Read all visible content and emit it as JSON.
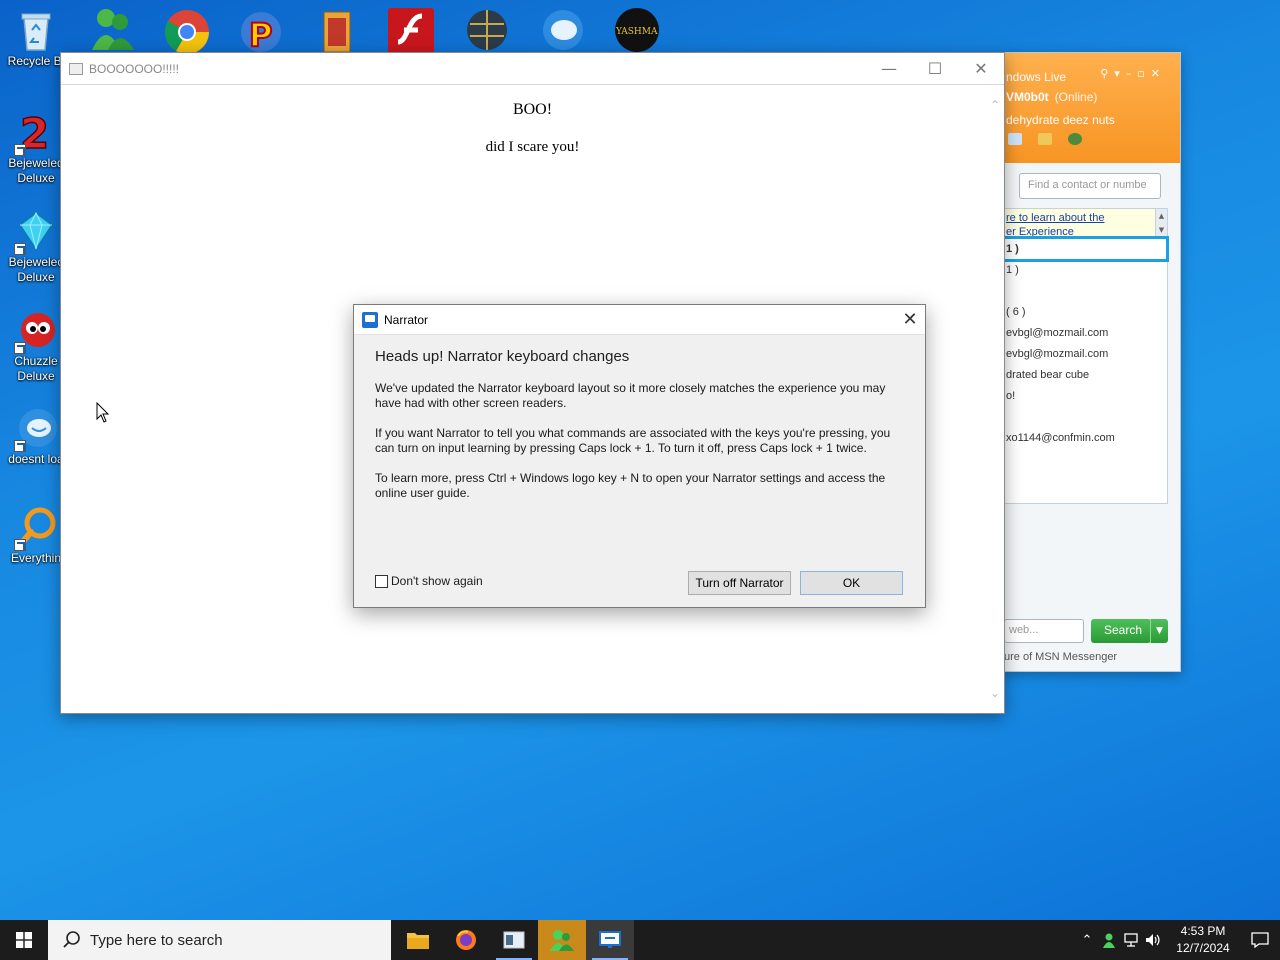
{
  "desktop": {
    "icons": [
      {
        "label": "Recycle Bi",
        "icon": "recycle-bin-icon"
      },
      {
        "label": "Bejeweled",
        "label2": "Deluxe",
        "icon": "bejeweled2-icon"
      },
      {
        "label": "Bejewelec",
        "label2": "Deluxe",
        "icon": "bejeweled-icon"
      },
      {
        "label": "Chuzzle",
        "label2": "Deluxe",
        "icon": "chuzzle-icon"
      },
      {
        "label": "doesnt loa",
        "icon": "messenger-bird-icon"
      },
      {
        "label": "Everythin",
        "icon": "everything-search-icon"
      }
    ],
    "top_row_icons": [
      "msn-buddies-icon",
      "chrome-icon",
      "peggle-icon",
      "winamp-icon",
      "flash-icon",
      "globe-app-icon",
      "messenger-live-icon",
      "yashma-icon"
    ],
    "yashma_text": "YASHMA"
  },
  "browser": {
    "title": "BOOOOOOO!!!!!",
    "heading": "BOO!",
    "paragraph": "did I scare you!"
  },
  "messenger": {
    "header_title": "ndows Live",
    "user_name": "VM0b0t",
    "status": "(Online)",
    "personal_msg": "dehydrate deez nuts",
    "search_placeholder": "Find a contact or numbe",
    "banner_line1": "re to learn about the",
    "banner_line2": "er Experience",
    "list_items": [
      "1 )",
      "1 )",
      "( 6 )",
      "evbgl@mozmail.com",
      "evbgl@mozmail.com",
      "drated bear cube",
      "o!",
      "xo1144@confmin.com"
    ],
    "web_placeholder": "web...",
    "search_button": "Search",
    "footer": "ure of MSN Messenger"
  },
  "narrator": {
    "title": "Narrator",
    "heading": "Heads up! Narrator keyboard changes",
    "p1": "We've updated the Narrator keyboard layout so it more closely matches the experience you may have had with other screen readers.",
    "p2": "If you want Narrator to tell you what commands are associated with the keys you're pressing, you can turn on input learning by pressing Caps lock + 1. To turn it off, press Caps lock + 1 twice.",
    "p3": "To learn more, press Ctrl + Windows logo key + N to open your Narrator settings and access the online user guide.",
    "checkbox_label": "Don't show again",
    "turn_off_button": "Turn off Narrator",
    "ok_button": "OK"
  },
  "taskbar": {
    "search_placeholder": "Type here to search",
    "time": "4:53 PM",
    "date": "12/7/2024"
  }
}
